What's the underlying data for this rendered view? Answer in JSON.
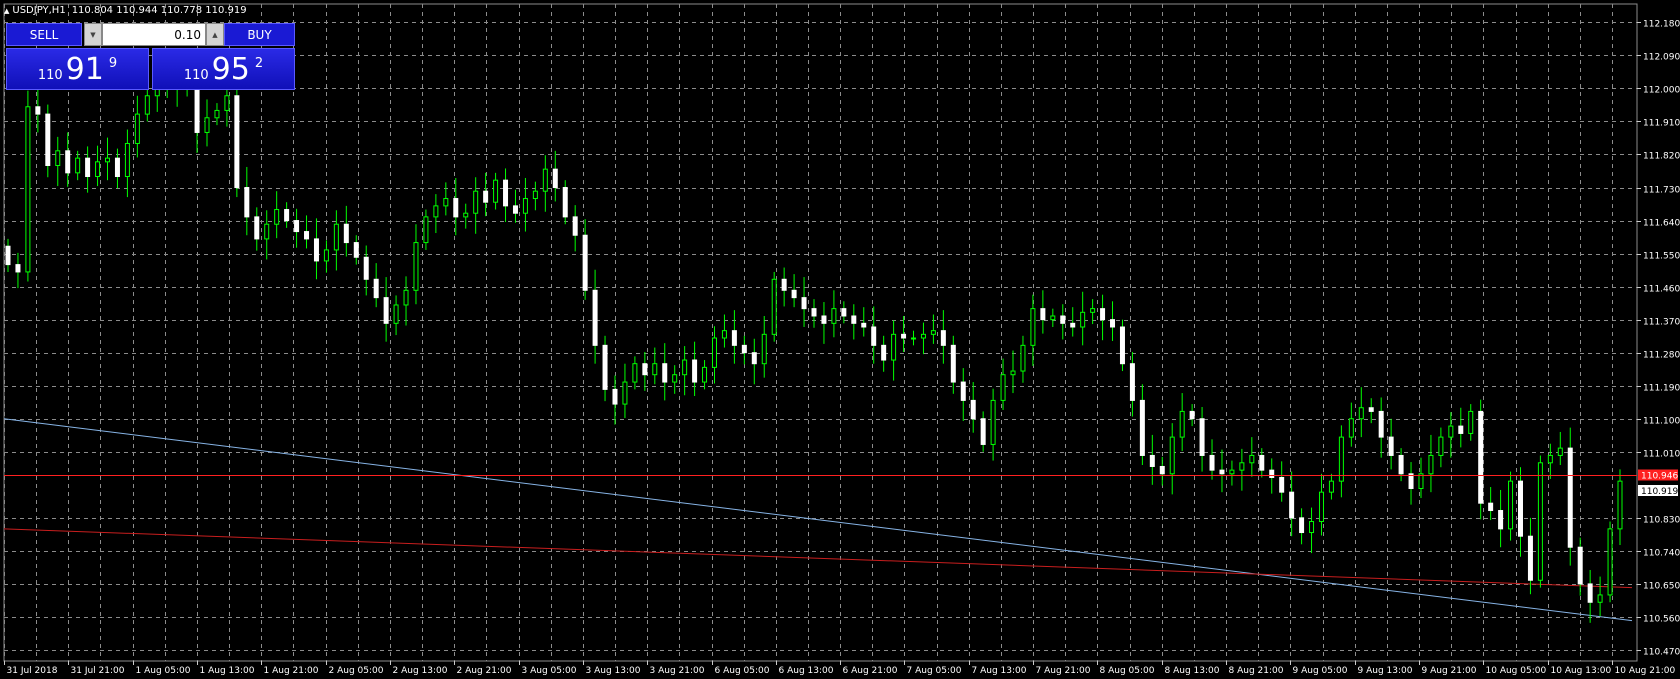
{
  "header": {
    "symbol": "USDJPY,H1",
    "ohlc": "110.804 110.944 110.778 110.919"
  },
  "trade_panel": {
    "sell_label": "SELL",
    "buy_label": "BUY",
    "lot_size": "0.10",
    "sell_price": {
      "small": "110",
      "big": "91",
      "sup": "9"
    },
    "buy_price": {
      "small": "110",
      "big": "95",
      "sup": "2"
    }
  },
  "colors": {
    "background": "#000000",
    "grid": "#8c8c8c",
    "bull_candle": "#00ff00",
    "bear_candle": "#ffffff",
    "panel_blue": "#1a1ad4",
    "trendline_blue": "#87b4e6",
    "trendline_red": "#c81e1e",
    "ask_line": "#ff2020"
  },
  "chart_data": {
    "type": "candlestick",
    "symbol": "USDJPY",
    "timeframe": "H1",
    "ylim": [
      110.44,
      112.23
    ],
    "y_ticks": [
      "112.180",
      "112.090",
      "112.000",
      "111.910",
      "111.820",
      "111.730",
      "111.640",
      "111.550",
      "111.460",
      "111.370",
      "111.280",
      "111.190",
      "111.100",
      "111.010",
      "110.830",
      "110.740",
      "110.650",
      "110.560",
      "110.470"
    ],
    "x_ticks": [
      "31 Jul 2018",
      "31 Jul 21:00",
      "1 Aug 05:00",
      "1 Aug 13:00",
      "1 Aug 21:00",
      "2 Aug 05:00",
      "2 Aug 13:00",
      "2 Aug 21:00",
      "3 Aug 05:00",
      "3 Aug 13:00",
      "3 Aug 21:00",
      "6 Aug 05:00",
      "6 Aug 13:00",
      "6 Aug 21:00",
      "7 Aug 05:00",
      "7 Aug 13:00",
      "7 Aug 21:00",
      "8 Aug 05:00",
      "8 Aug 13:00",
      "8 Aug 21:00",
      "9 Aug 05:00",
      "9 Aug 13:00",
      "9 Aug 21:00",
      "10 Aug 05:00",
      "10 Aug 13:00",
      "10 Aug 21:00"
    ],
    "closes": [
      111.52,
      111.5,
      111.95,
      111.93,
      111.79,
      111.83,
      111.77,
      111.81,
      111.76,
      111.8,
      111.81,
      111.76,
      111.85,
      111.93,
      111.98,
      112.02,
      112.0,
      112.03,
      112.01,
      111.88,
      111.92,
      111.94,
      111.98,
      111.73,
      111.65,
      111.59,
      111.63,
      111.67,
      111.64,
      111.61,
      111.59,
      111.53,
      111.56,
      111.63,
      111.58,
      111.54,
      111.48,
      111.43,
      111.36,
      111.41,
      111.45,
      111.58,
      111.65,
      111.68,
      111.7,
      111.65,
      111.66,
      111.72,
      111.69,
      111.75,
      111.68,
      111.66,
      111.7,
      111.72,
      111.78,
      111.73,
      111.65,
      111.6,
      111.45,
      111.3,
      111.18,
      111.14,
      111.2,
      111.25,
      111.22,
      111.25,
      111.2,
      111.22,
      111.26,
      111.2,
      111.24,
      111.32,
      111.34,
      111.3,
      111.28,
      111.25,
      111.33,
      111.48,
      111.45,
      111.43,
      111.4,
      111.38,
      111.36,
      111.4,
      111.38,
      111.36,
      111.35,
      111.3,
      111.26,
      111.33,
      111.32,
      111.32,
      111.33,
      111.34,
      111.3,
      111.2,
      111.15,
      111.1,
      111.03,
      111.15,
      111.22,
      111.23,
      111.3,
      111.4,
      111.37,
      111.38,
      111.36,
      111.35,
      111.39,
      111.4,
      111.37,
      111.35,
      111.25,
      111.15,
      111.0,
      110.97,
      110.95,
      111.05,
      111.12,
      111.1,
      111.0,
      110.96,
      110.95,
      110.96,
      110.98,
      111.0,
      110.96,
      110.94,
      110.9,
      110.83,
      110.79,
      110.82,
      110.9,
      110.93,
      111.05,
      111.1,
      111.13,
      111.12,
      111.05,
      111.0,
      110.95,
      110.91,
      110.95,
      111.0,
      111.05,
      111.08,
      111.06,
      111.12,
      110.87,
      110.85,
      110.8,
      110.93,
      110.78,
      110.66,
      110.98,
      111.0,
      111.02,
      110.75,
      110.65,
      110.6,
      110.62,
      110.8,
      110.93
    ],
    "trendlines": [
      {
        "color": "#87b4e6",
        "from": {
          "x": "31 Jul 2018",
          "y": 111.1
        },
        "to": {
          "x": "10 Aug 21:00",
          "y": 110.55
        }
      },
      {
        "color": "#c81e1e",
        "from": {
          "x": "31 Jul 2018",
          "y": 110.8
        },
        "to": {
          "x": "10 Aug 21:00",
          "y": 110.64
        }
      }
    ],
    "ask_line": {
      "value": 110.946,
      "label": "110.946"
    },
    "bid_line": {
      "value": 110.919,
      "label": "110.919"
    }
  }
}
